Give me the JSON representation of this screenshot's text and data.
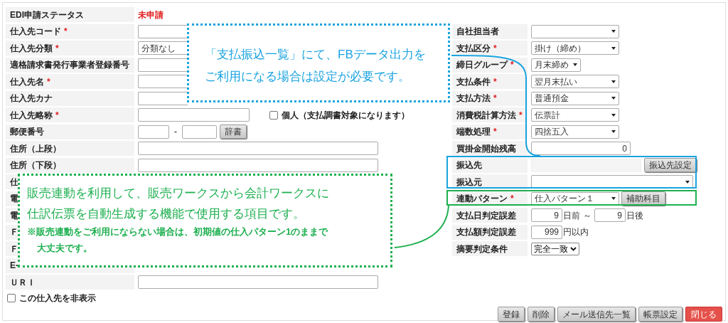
{
  "status": {
    "label": "EDI申請ステータス",
    "value": "未申請"
  },
  "left_rows": [
    {
      "kind": "text_cut",
      "label": "仕入先コード",
      "mark": "*"
    },
    {
      "kind": "select_cut",
      "label": "仕入先分類",
      "mark": "*",
      "value": "分類なし"
    },
    {
      "kind": "text_cut",
      "label": "適格請求書発行事業者登録番号"
    },
    {
      "kind": "text_cut",
      "label": "仕入先名",
      "mark": "*"
    },
    {
      "kind": "text_cut",
      "label": "仕入先カナ"
    },
    {
      "kind": "text_check",
      "label": "仕入先略称",
      "mark": "*",
      "checkbox": {
        "label": "個人（支払調書対象になります）",
        "checked": false
      }
    },
    {
      "kind": "postal",
      "label": "郵便番号",
      "separator": "-",
      "button": "辞書"
    },
    {
      "kind": "text_wide",
      "label": "住所（上段）"
    },
    {
      "kind": "text_wide",
      "label": "住所（下段）"
    },
    {
      "kind": "covered",
      "label": "仕"
    },
    {
      "kind": "covered",
      "label": "電"
    },
    {
      "kind": "covered",
      "label": "電"
    },
    {
      "kind": "covered",
      "label": "Ｆ"
    },
    {
      "kind": "covered",
      "label": "Ｆ"
    },
    {
      "kind": "covered",
      "label": "E-"
    },
    {
      "kind": "text_wide",
      "label": "ＵＲＩ"
    }
  ],
  "hide_checkbox": {
    "label": "この仕入先を非表示",
    "checked": false
  },
  "right_rows": [
    {
      "kind": "select",
      "label": "自社担当者"
    },
    {
      "kind": "select",
      "label": "支払区分",
      "mark": "*",
      "value": "掛け（締め）"
    },
    {
      "kind": "select_narrow",
      "label": "締日グループ",
      "mark": "*",
      "value": "月末締め"
    },
    {
      "kind": "select",
      "label": "支払条件",
      "mark": "*",
      "value": "翌月末払い"
    },
    {
      "kind": "select",
      "label": "支払方法",
      "mark": "*",
      "value": "普通預金"
    },
    {
      "kind": "select",
      "label": "消費税計算方法",
      "mark": "*",
      "value": "伝票計"
    },
    {
      "kind": "select",
      "label": "端数処理",
      "mark": "*",
      "value": "四捨五入"
    },
    {
      "kind": "amount",
      "label": "買掛金開始残高",
      "value": "0"
    },
    {
      "kind": "account",
      "label": "振込先",
      "button": "振込先設定"
    },
    {
      "kind": "select_wide",
      "label": "振込元"
    },
    {
      "kind": "select_button",
      "label": "連動パターン",
      "mark": "*",
      "value": "仕入パターン１",
      "button": "補助科目"
    },
    {
      "kind": "range",
      "label": "支払日判定誤差",
      "from": "9",
      "from_suffix": "日前",
      "separator": "～",
      "to": "9",
      "to_suffix": "日後"
    },
    {
      "kind": "amount_suffix",
      "label": "支払額判定誤差",
      "value": "999",
      "suffix": "円以内"
    },
    {
      "kind": "native_select",
      "label": "摘要判定条件",
      "value": "完全一致"
    }
  ],
  "buttons": [
    {
      "label": "登録",
      "kind": "normal"
    },
    {
      "label": "削除",
      "kind": "normal"
    },
    {
      "label": "メール送信先一覧",
      "kind": "normal"
    },
    {
      "label": "帳票設定",
      "kind": "normal"
    },
    {
      "label": "閉じる",
      "kind": "danger"
    }
  ],
  "callouts": [
    {
      "color": "#1aa3e0",
      "lines": [
        {
          "kind": "main",
          "text": "「支払振込一覧」にて、FBデータ出力を"
        },
        {
          "kind": "main",
          "text": "ご利用になる場合は設定が必要です。"
        }
      ]
    },
    {
      "color": "#1eb050",
      "lines": [
        {
          "kind": "main",
          "text": "販売連動を利用して、販売ワークスから会計ワークスに"
        },
        {
          "kind": "main",
          "text": "仕訳伝票を自動生成する機能で使用する項目です。"
        },
        {
          "kind": "note",
          "text": "※販売連動をご利用にならない場合は、初期値の仕入パターン1のままで"
        },
        {
          "kind": "note_cont",
          "text": "大丈夫です。"
        }
      ]
    }
  ]
}
